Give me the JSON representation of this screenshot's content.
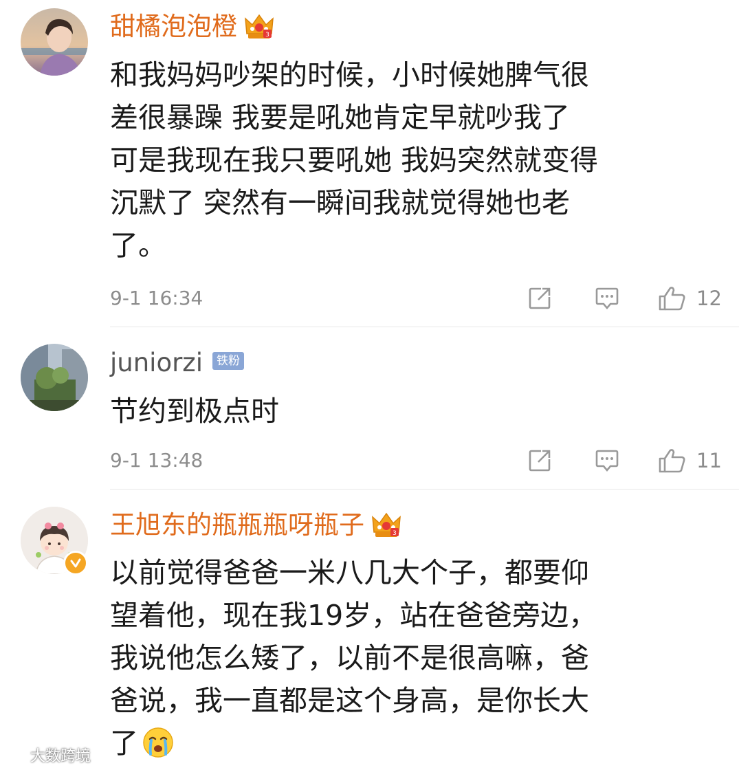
{
  "comments": [
    {
      "username": "甜橘泡泡橙",
      "username_color": "#e06b1c",
      "badge": "crown-icon",
      "lines": [
        "和我妈妈吵架的时候，小时候她脾气很",
        "差很暴躁  我要是吼她肯定早就吵我了",
        "可是我现在我只要吼她  我妈突然就变得",
        "沉默了  突然有一瞬间我就觉得她也老",
        "了。"
      ],
      "timestamp": "9-1 16:34",
      "likes": "12"
    },
    {
      "username": "juniorzi",
      "username_color": "#555555",
      "badge_text": "铁粉",
      "lines": [
        "节约到极点时"
      ],
      "timestamp": "9-1 13:48",
      "likes": "11"
    },
    {
      "username": "王旭东的瓶瓶瓶呀瓶子",
      "username_color": "#e06b1c",
      "badge": "crown-icon",
      "verified": true,
      "lines": [
        "以前觉得爸爸一米八几大个子，都要仰",
        "望着他，现在我19岁，站在爸爸旁边，",
        "我说他怎么矮了，以前不是很高嘛，爸",
        "爸说，我一直都是这个身高，是你长大",
        "了"
      ],
      "trailing_emoji": "crying-face-emoji"
    }
  ],
  "icons": {
    "repost": "share-icon",
    "comment": "comment-icon",
    "like": "thumbs-up-icon"
  },
  "watermark": {
    "text": "大数跨境"
  }
}
